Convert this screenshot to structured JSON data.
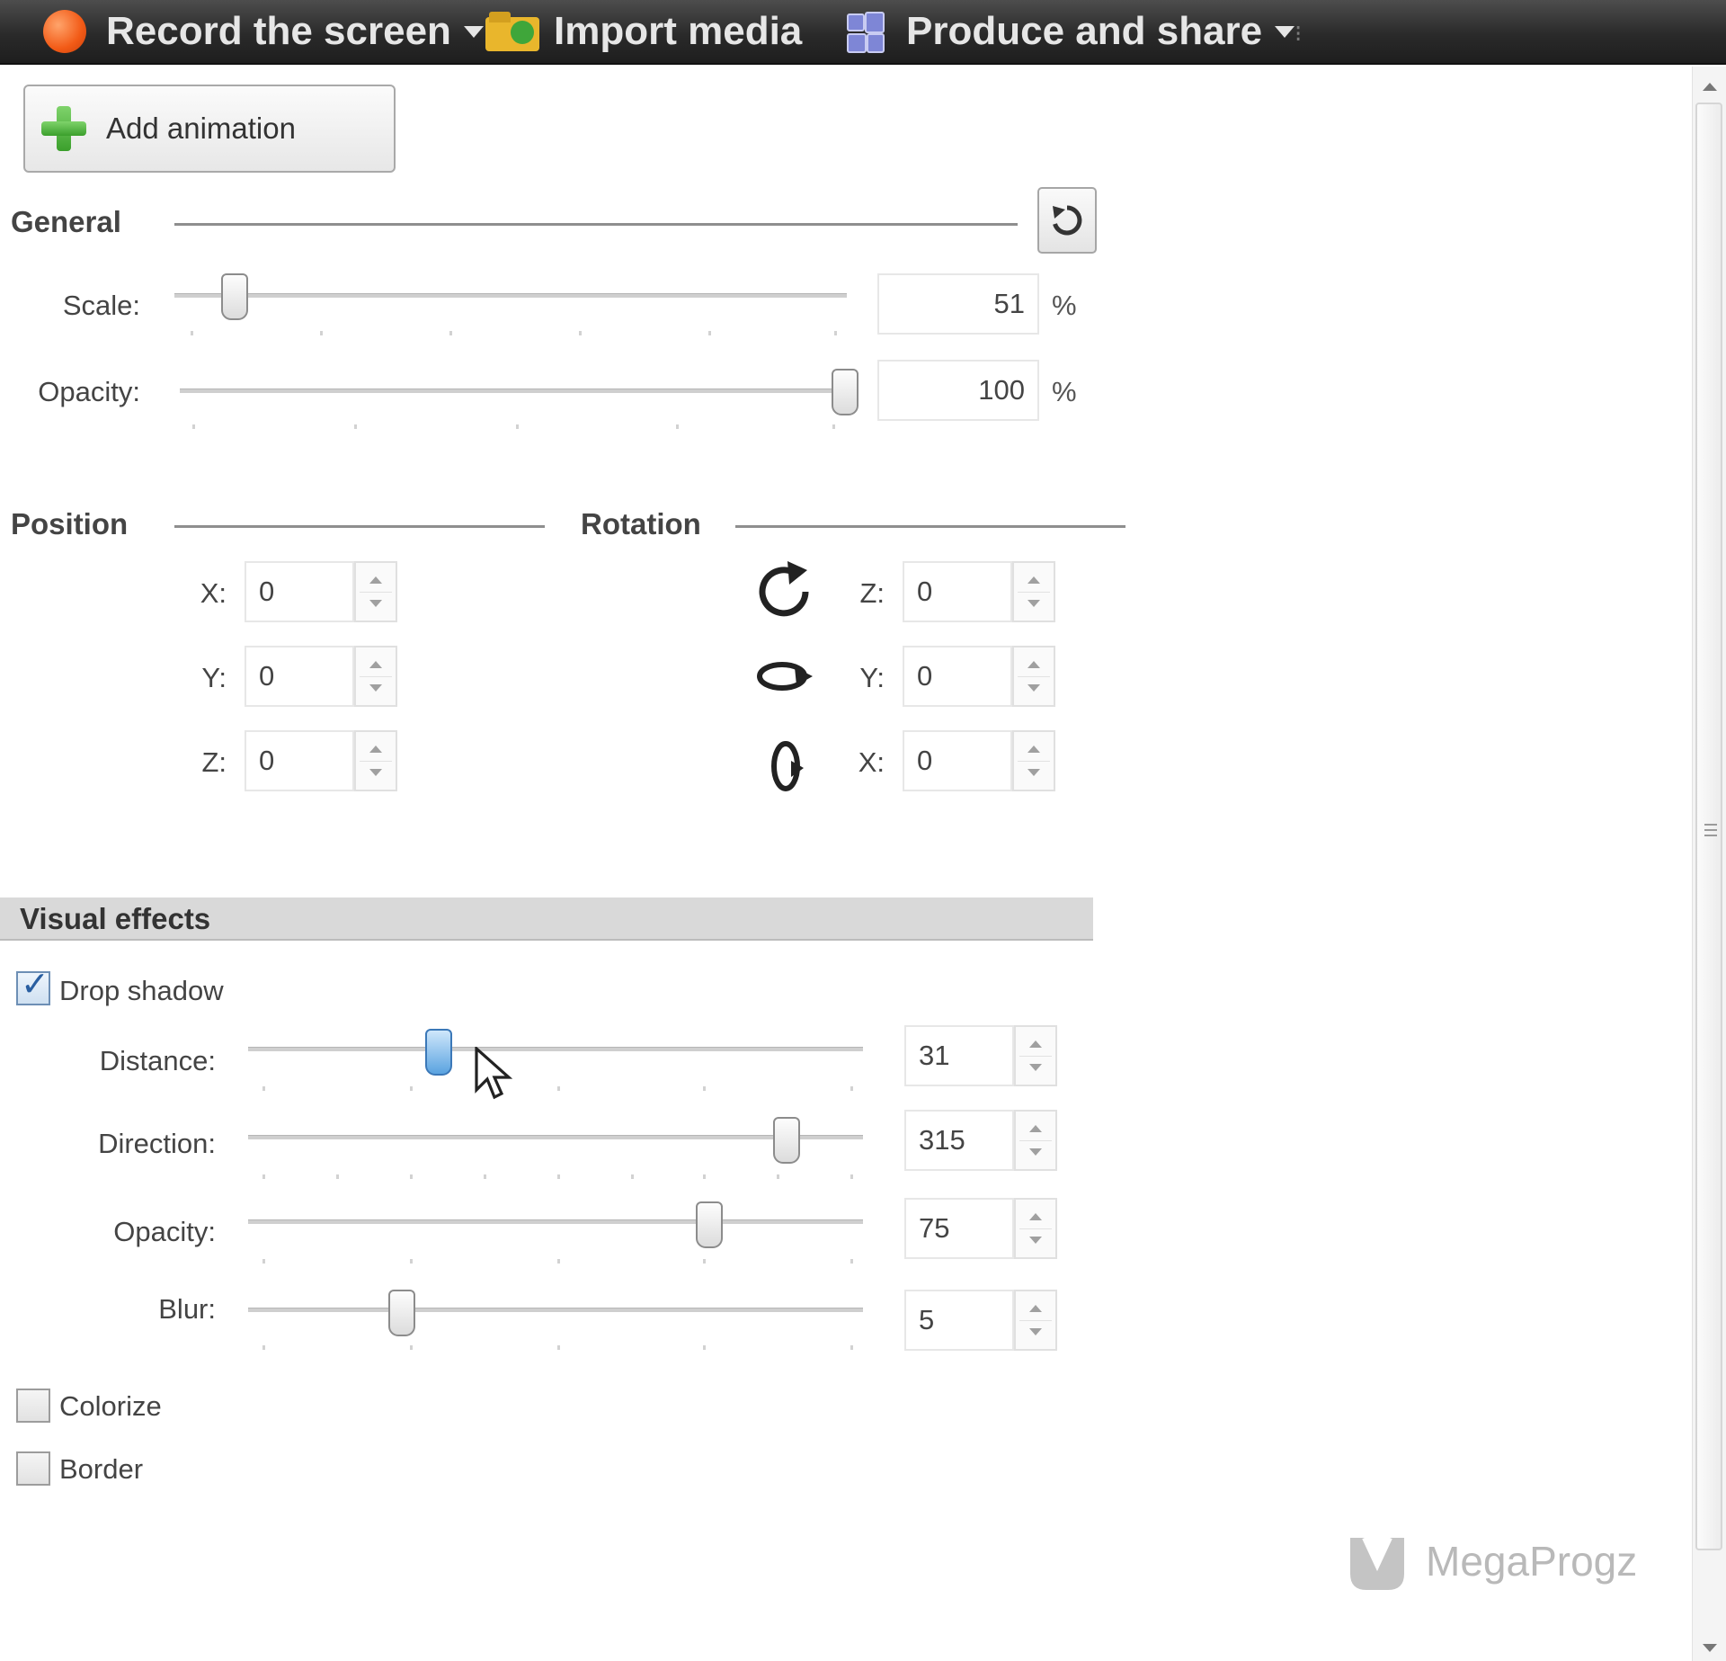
{
  "toolbar": {
    "record_label": "Record the screen",
    "import_label": "Import media",
    "produce_label": "Produce and share",
    "more_glyph": "⁝"
  },
  "add_animation": {
    "label": "Add animation"
  },
  "general": {
    "title": "General",
    "scale": {
      "label": "Scale:",
      "value": "51",
      "unit": "%",
      "fraction": 0.09
    },
    "opacity": {
      "label": "Opacity:",
      "value": "100",
      "unit": "%",
      "fraction": 1.0
    }
  },
  "position": {
    "title": "Position",
    "x": {
      "label": "X:",
      "value": "0"
    },
    "y": {
      "label": "Y:",
      "value": "0"
    },
    "z": {
      "label": "Z:",
      "value": "0"
    }
  },
  "rotation": {
    "title": "Rotation",
    "z": {
      "label": "Z:",
      "value": "0",
      "icon": "rotate-z-icon"
    },
    "y": {
      "label": "Y:",
      "value": "0",
      "icon": "rotate-y-icon"
    },
    "x": {
      "label": "X:",
      "value": "0",
      "icon": "rotate-x-icon"
    }
  },
  "visual_effects": {
    "title": "Visual effects",
    "drop_shadow": {
      "label": "Drop shadow",
      "checked": true,
      "distance": {
        "label": "Distance:",
        "value": "31",
        "fraction": 0.31
      },
      "direction": {
        "label": "Direction:",
        "value": "315",
        "fraction": 0.875
      },
      "opacity": {
        "label": "Opacity:",
        "value": "75",
        "fraction": 0.75
      },
      "blur": {
        "label": "Blur:",
        "value": "5",
        "fraction": 0.25
      }
    },
    "colorize": {
      "label": "Colorize",
      "checked": false
    },
    "border": {
      "label": "Border",
      "checked": false
    }
  },
  "watermark": {
    "text": "MegaProgz"
  },
  "colors": {
    "toolbar_bg": "#2a2a2a",
    "toolbar_text": "#e6e6e6",
    "section_bg": "#d9d9d9",
    "accent_thumb": "#5aa3e0"
  }
}
